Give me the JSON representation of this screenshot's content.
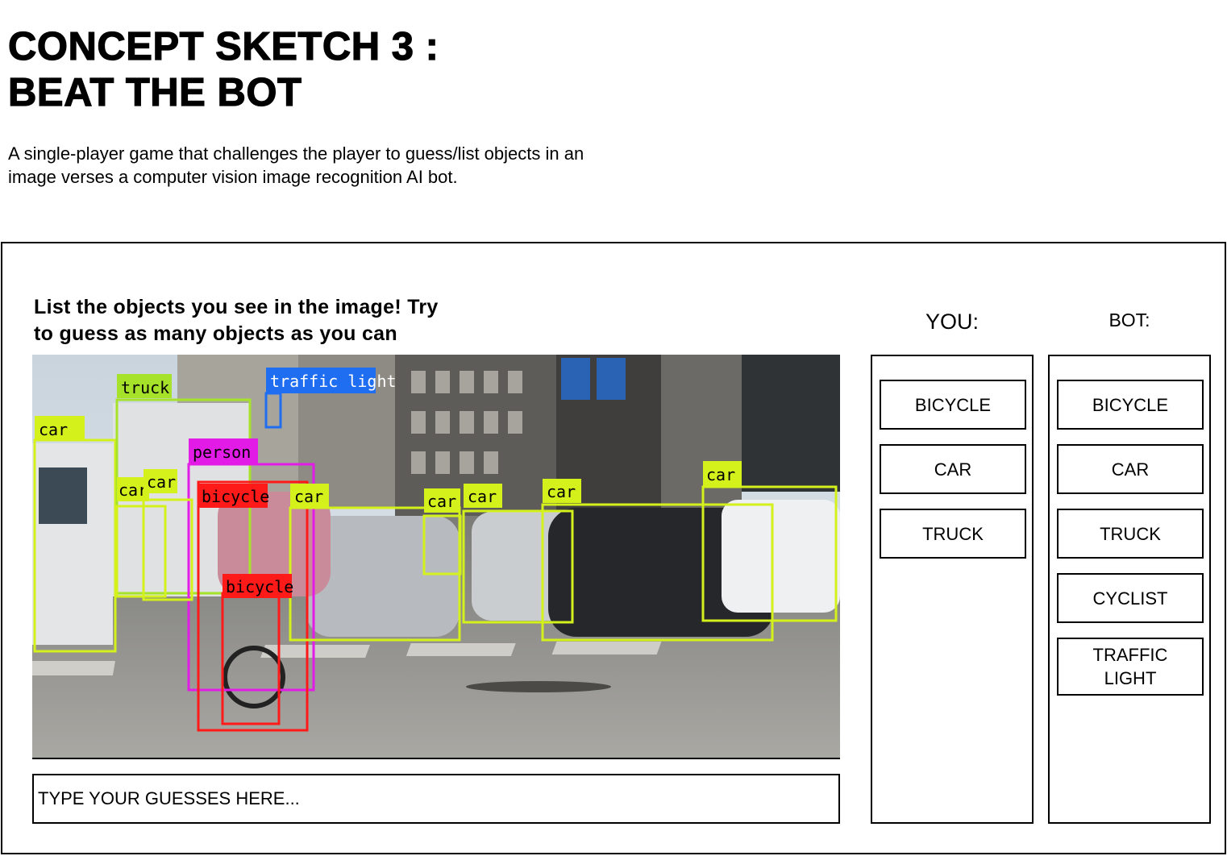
{
  "page": {
    "title_line1": "CONCEPT SKETCH 3 :",
    "title_line2": "BEAT THE BOT",
    "description": "A single-player game that challenges the player to guess/list objects in an image verses a computer vision image recognition AI bot."
  },
  "game": {
    "prompt_line1": "List the objects you see in the image! Try",
    "prompt_line2": "to guess as many objects as you can",
    "input_placeholder": "TYPE YOUR GUESSES HERE...",
    "you_label": "YOU:",
    "bot_label": "BOT:",
    "you_answers": [
      "BICYCLE",
      "CAR",
      "TRUCK"
    ],
    "bot_answers": [
      "BICYCLE",
      "CAR",
      "TRUCK",
      "CYCLIST",
      "TRAFFIC\nLIGHT"
    ]
  },
  "scene": {
    "detection_labels": {
      "truck": "truck",
      "traffic_light": "traffic light",
      "person": "person",
      "bicycle": "bicycle",
      "car": "car"
    },
    "colors": {
      "car": "#d4f11c",
      "truck": "#a6e22a",
      "person": "#e21ce6",
      "bicycle": "#ff1a1a",
      "traffic_light": "#1f6df0"
    }
  }
}
